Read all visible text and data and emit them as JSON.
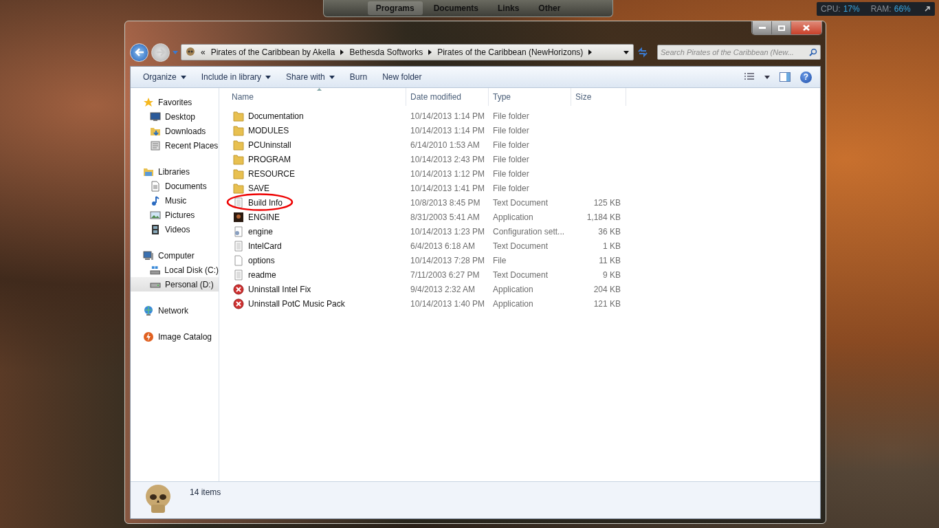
{
  "dock": {
    "tabs": [
      {
        "label": "Programs",
        "selected": true
      },
      {
        "label": "Documents",
        "selected": false
      },
      {
        "label": "Links",
        "selected": false
      },
      {
        "label": "Other",
        "selected": false
      }
    ]
  },
  "meter": {
    "cpu_label": "CPU:",
    "cpu_value": "17%",
    "ram_label": "RAM:",
    "ram_value": "66%"
  },
  "address": {
    "overflow": "«",
    "segments": [
      "Pirates of the Caribbean by Akella",
      "Bethesda Softworks",
      "Pirates of the Caribbean (NewHorizons)"
    ]
  },
  "search": {
    "placeholder": "Search Pirates of the Caribbean (New..."
  },
  "toolbar": [
    {
      "label": "Organize",
      "menu": true
    },
    {
      "label": "Include in library",
      "menu": true
    },
    {
      "label": "Share with",
      "menu": true
    },
    {
      "label": "Burn",
      "menu": false
    },
    {
      "label": "New folder",
      "menu": false
    }
  ],
  "sidebar": [
    {
      "label": "Favorites",
      "kind": "star",
      "selected": false,
      "children": [
        {
          "label": "Desktop",
          "kind": "desktop",
          "selected": false
        },
        {
          "label": "Downloads",
          "kind": "downloads",
          "selected": false
        },
        {
          "label": "Recent Places",
          "kind": "recent",
          "selected": false
        }
      ]
    },
    {
      "label": "Libraries",
      "kind": "libraries",
      "selected": false,
      "children": [
        {
          "label": "Documents",
          "kind": "documents",
          "selected": false
        },
        {
          "label": "Music",
          "kind": "music",
          "selected": false
        },
        {
          "label": "Pictures",
          "kind": "pictures",
          "selected": false
        },
        {
          "label": "Videos",
          "kind": "videos",
          "selected": false
        }
      ]
    },
    {
      "label": "Computer",
      "kind": "computer",
      "selected": false,
      "children": [
        {
          "label": "Local Disk (C:)",
          "kind": "disk",
          "selected": false
        },
        {
          "label": "Personal (D:)",
          "kind": "drive",
          "selected": true
        }
      ]
    },
    {
      "label": "Network",
      "kind": "network",
      "selected": false
    },
    {
      "label": "Image Catalog",
      "kind": "catalog",
      "selected": false
    }
  ],
  "help": {
    "label": "?"
  },
  "columns": [
    {
      "label": "Name",
      "sorted": true
    },
    {
      "label": "Date modified",
      "sorted": false
    },
    {
      "label": "Type",
      "sorted": false
    },
    {
      "label": "Size",
      "sorted": false
    }
  ],
  "files": [
    {
      "name": "Documentation",
      "kind": "folder",
      "date": "10/14/2013 1:14 PM",
      "type": "File folder",
      "circled": false
    },
    {
      "name": "MODULES",
      "kind": "folder",
      "date": "10/14/2013 1:14 PM",
      "type": "File folder",
      "circled": false
    },
    {
      "name": "PCUninstall",
      "kind": "folder",
      "date": "6/14/2010 1:53 AM",
      "type": "File folder",
      "circled": false
    },
    {
      "name": "PROGRAM",
      "kind": "folder",
      "date": "10/14/2013 2:43 PM",
      "type": "File folder",
      "circled": false
    },
    {
      "name": "RESOURCE",
      "kind": "folder",
      "date": "10/14/2013 1:12 PM",
      "type": "File folder",
      "circled": false
    },
    {
      "name": "SAVE",
      "kind": "folder",
      "date": "10/14/2013 1:41 PM",
      "type": "File folder",
      "circled": false
    },
    {
      "name": "Build Info",
      "kind": "text",
      "date": "10/8/2013 8:45 PM",
      "type": "Text Document",
      "size": "125 KB",
      "circled": true
    },
    {
      "name": "ENGINE",
      "kind": "app",
      "date": "8/31/2003 5:41 AM",
      "type": "Application",
      "size": "1,184 KB",
      "circled": false
    },
    {
      "name": "engine",
      "kind": "config",
      "date": "10/14/2013 1:23 PM",
      "type": "Configuration sett...",
      "size": "36 KB",
      "circled": false
    },
    {
      "name": "IntelCard",
      "kind": "text",
      "date": "6/4/2013 6:18 AM",
      "type": "Text Document",
      "size": "1 KB",
      "circled": false
    },
    {
      "name": "options",
      "kind": "file",
      "date": "10/14/2013 7:28 PM",
      "type": "File",
      "size": "11 KB",
      "circled": false
    },
    {
      "name": "readme",
      "kind": "text",
      "date": "7/11/2003 6:27 PM",
      "type": "Text Document",
      "size": "9 KB",
      "circled": false
    },
    {
      "name": "Uninstall Intel Fix",
      "kind": "uninstall",
      "date": "9/4/2013 2:32 AM",
      "type": "Application",
      "size": "204 KB",
      "circled": false
    },
    {
      "name": "Uninstall PotC Music Pack",
      "kind": "uninstall",
      "date": "10/14/2013 1:40 PM",
      "type": "Application",
      "size": "121 KB",
      "circled": false
    }
  ],
  "status": {
    "count": "14 items"
  }
}
